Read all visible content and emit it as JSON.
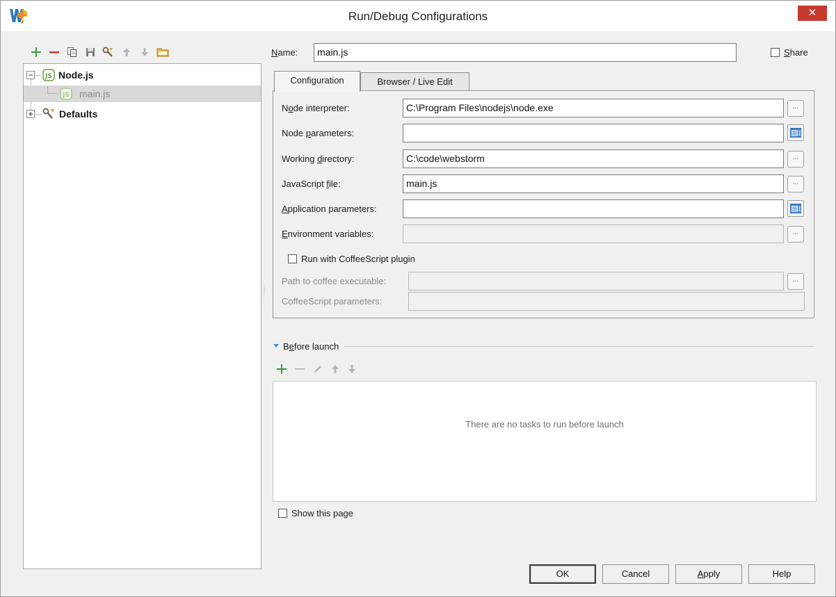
{
  "window": {
    "title": "Run/Debug Configurations",
    "close_glyph": "✕"
  },
  "left_toolbar": {
    "icons": [
      "add-icon",
      "remove-icon",
      "copy-icon",
      "save-icon",
      "edit-defaults-icon",
      "move-up-icon",
      "move-down-icon",
      "folder-icon"
    ]
  },
  "tree": {
    "nodejs_label": "Node.js",
    "mainjs_label": "main.js",
    "defaults_label": "Defaults"
  },
  "name_row": {
    "label_u": "N",
    "label_rest": "ame:",
    "value": "main.js",
    "share_u": "S",
    "share_rest": "hare"
  },
  "tabs": {
    "configuration": "Configuration",
    "browser": "Browser / Live Edit"
  },
  "config": {
    "node_interpreter_a": "N",
    "node_interpreter_u": "o",
    "node_interpreter_b": "de interpreter:",
    "node_interpreter_value": "C:\\Program Files\\nodejs\\node.exe",
    "node_parameters_a": "Node ",
    "node_parameters_u": "p",
    "node_parameters_b": "arameters:",
    "node_parameters_value": "",
    "working_dir_a": "Working ",
    "working_dir_u": "d",
    "working_dir_b": "irectory:",
    "working_dir_value": "C:\\code\\webstorm",
    "js_file_a": "JavaScript ",
    "js_file_u": "f",
    "js_file_b": "ile:",
    "js_file_value": "main.js",
    "app_params_u": "A",
    "app_params_b": "pplication parameters:",
    "app_params_value": "",
    "env_vars_u": "E",
    "env_vars_b": "nvironment variables:",
    "env_vars_value": "",
    "coffee_checkbox": "Run with CoffeeScript plugin",
    "coffee_path_label": "Path to coffee executable:",
    "coffee_path_value": "",
    "coffee_params_label": "CoffeeScript parameters:",
    "coffee_params_value": "",
    "browse_glyph": "..."
  },
  "before_launch": {
    "title_a": "B",
    "title_u": "e",
    "title_b": "fore launch",
    "empty_message": "There are no tasks to run before launch",
    "show_page": "Show this page"
  },
  "buttons": {
    "ok": "OK",
    "cancel": "Cancel",
    "apply_u": "A",
    "apply_b": "pply",
    "help": "Help"
  },
  "colors": {
    "add_green": "#3c9a3c",
    "remove_red": "#c8372d",
    "close_red": "#c7392f",
    "node_green": "#6a9e3c"
  }
}
